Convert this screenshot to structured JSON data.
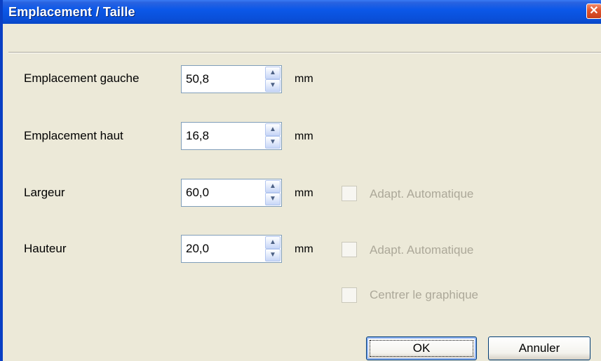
{
  "window": {
    "title": "Emplacement / Taille",
    "close_icon": "close-icon"
  },
  "fields": [
    {
      "label": "Emplacement gauche",
      "value": "50,8",
      "unit": "mm"
    },
    {
      "label": "Emplacement haut",
      "value": "16,8",
      "unit": "mm"
    },
    {
      "label": "Largeur",
      "value": "60,0",
      "unit": "mm"
    },
    {
      "label": "Hauteur",
      "value": "20,0",
      "unit": "mm"
    }
  ],
  "checkboxes": [
    {
      "label": "Adapt. Automatique",
      "checked": false,
      "enabled": false
    },
    {
      "label": "Adapt. Automatique",
      "checked": false,
      "enabled": false
    },
    {
      "label": "Centrer le graphique",
      "checked": false,
      "enabled": false
    }
  ],
  "buttons": {
    "ok_label": "OK",
    "cancel_label": "Annuler"
  },
  "colors": {
    "titlebar": "#0a4fd8",
    "dialog_bg": "#ece9d8",
    "disabled_text": "#aca899",
    "close_button": "#e0532c"
  }
}
